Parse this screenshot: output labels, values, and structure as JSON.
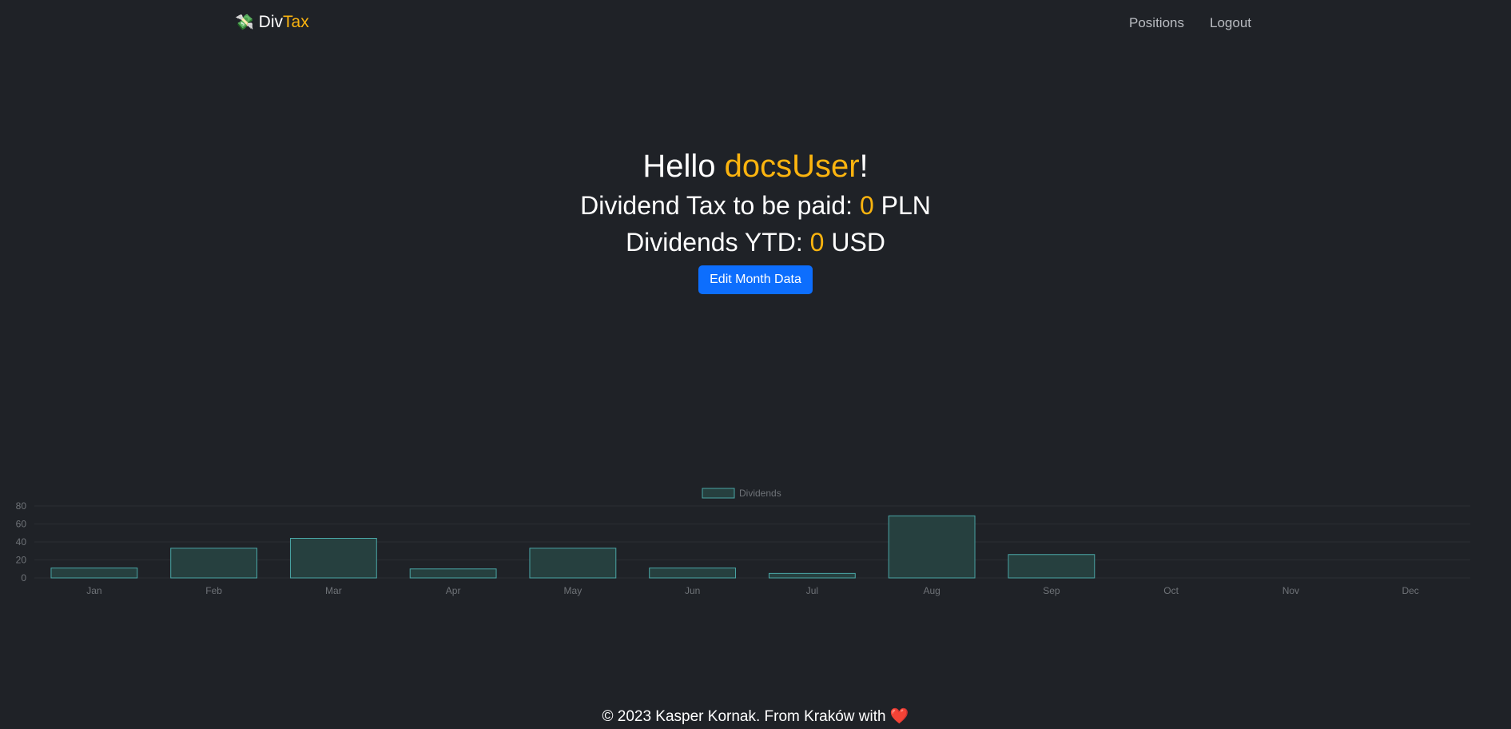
{
  "nav": {
    "brand_icon": "money-with-wings-icon",
    "brand_part1": "Div",
    "brand_part2": "Tax",
    "links": [
      "Positions",
      "Logout"
    ]
  },
  "hero": {
    "hello_prefix": "Hello ",
    "username": "docsUser",
    "hello_suffix": "!",
    "tax_label": "Dividend Tax to be paid: ",
    "tax_value": "0",
    "tax_currency": " PLN",
    "ytd_label": "Dividends YTD: ",
    "ytd_value": "0",
    "ytd_currency": " USD",
    "edit_button": "Edit Month Data"
  },
  "chart_data": {
    "type": "bar",
    "categories": [
      "Jan",
      "Feb",
      "Mar",
      "Apr",
      "May",
      "Jun",
      "Jul",
      "Aug",
      "Sep",
      "Oct",
      "Nov",
      "Dec"
    ],
    "series": [
      {
        "name": "Dividends",
        "values": [
          11,
          33,
          44,
          10,
          33,
          11,
          5,
          69,
          26,
          0,
          0,
          0
        ]
      }
    ],
    "ylim": [
      0,
      80
    ],
    "yticks": [
      0,
      20,
      40,
      60,
      80
    ],
    "legend": "top-center",
    "grid": true,
    "bar_color": "#26403f",
    "bar_border": "#4aa6a6"
  },
  "footer": {
    "text": "© 2023 Kasper Kornak. From Kraków with ",
    "heart": "❤️"
  }
}
